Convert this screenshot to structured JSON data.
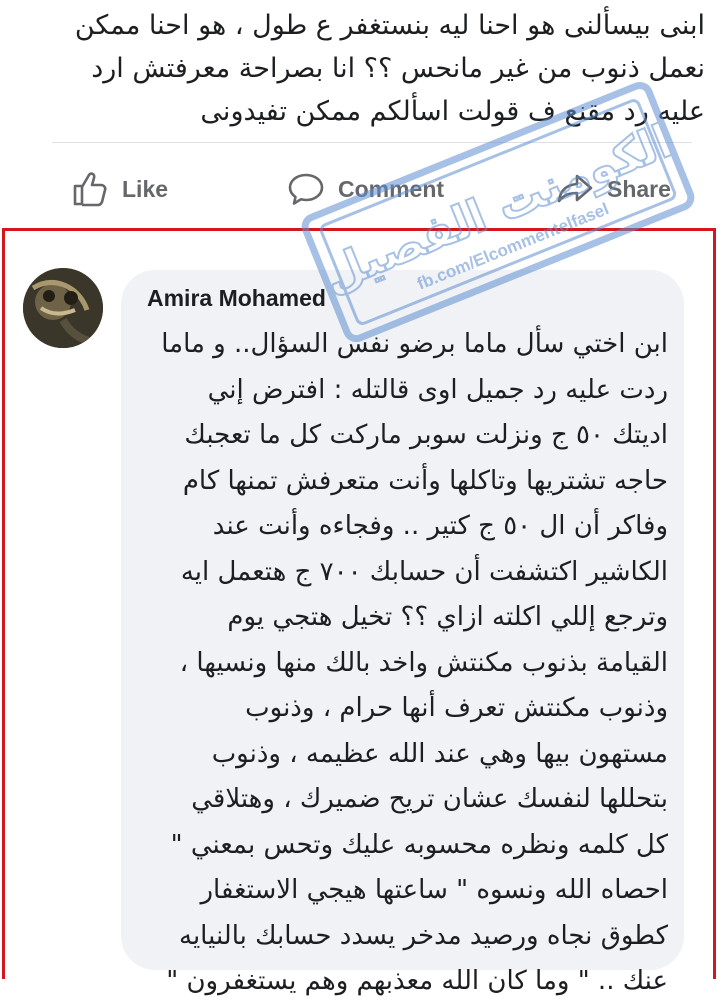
{
  "post": {
    "lines": [
      "ابنى بيسألنى هو احنا ليه بنستغفر ع طول ، هو احنا ممكن",
      "نعمل ذنوب من غير مانحس ؟؟ انا بصراحة معرفتش ارد",
      "عليه رد مقنع ف قولت اسألكم ممكن تفيدونى"
    ]
  },
  "actions": {
    "like": "Like",
    "comment": "Comment",
    "share": "Share"
  },
  "comment": {
    "author": "Amira Mohamed",
    "lines": [
      "ابن اختي سأل ماما برضو نفس السؤال.. و ماما",
      "ردت عليه رد جميل اوى قالتله : افترض إني",
      "اديتك ٥٠ ج ونزلت سوبر ماركت كل ما تعجبك",
      "حاجه تشتريها وتاكلها وأنت متعرفش تمنها كام",
      "وفاكر أن ال ٥٠ ج كتير .. وفجاءه وأنت عند",
      "الكاشير اكتشفت أن حسابك ٧٠٠ ج هتعمل ايه",
      "وترجع إللي اكلته ازاي ؟؟ تخيل هتجي يوم",
      "القيامة بذنوب مكنتش واخد بالك منها ونسيها ،",
      "وذنوب مكنتش تعرف أنها حرام ، وذنوب",
      "مستهون بيها وهي عند الله عظيمه ، وذنوب",
      "بتحللها لنفسك عشان تريح ضميرك ، وهتلاقي",
      "كل كلمه ونظره محسوبه عليك وتحس بمعني \"",
      "احصاه الله ونسوه \" ساعتها هيجي الاستغفار",
      "كطوق نجاه ورصيد مدخر يسدد حسابك بالنيايه",
      "عنك .. \" وما كان الله معذبهم وهم يستغفرون \""
    ]
  },
  "watermark": {
    "title": "الكومنت الفصيل",
    "url": "fb.com/Elcommentelfasel"
  },
  "colors": {
    "highlight_border": "#d4161d",
    "bubble_bg": "#f0f2f5",
    "action_gray": "#65676b",
    "watermark_blue": "#5f8fd0"
  },
  "icons": [
    "thumbs-up-icon",
    "speech-bubble-icon",
    "share-arrow-icon"
  ]
}
